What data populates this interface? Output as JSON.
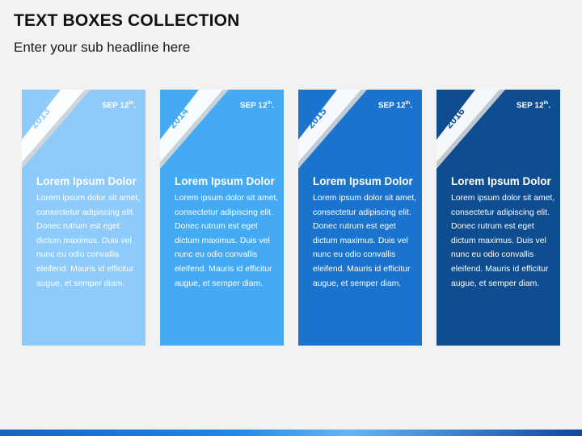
{
  "slide": {
    "title": "TEXT BOXES COLLECTION",
    "subtitle": "Enter your sub headline here"
  },
  "cards": [
    {
      "year": "2013",
      "date_main": "SEP 12",
      "date_suffix": "th",
      "date_tail": ".",
      "heading": "Lorem Ipsum Dolor",
      "body": "Lorem ipsum dolor sit amet, consectetur adipiscing elit. Donec rutrum est eget dictum maximus. Duis vel nunc eu odio convallis eleifend. Mauris id efficitur augue, et semper diam.",
      "color": "#8ecbfa"
    },
    {
      "year": "2014",
      "date_main": "SEP 12",
      "date_suffix": "th",
      "date_tail": ".",
      "heading": "Lorem Ipsum Dolor",
      "body": "Lorem ipsum dolor sit amet, consectetur adipiscing elit. Donec rutrum est eget dictum maximus. Duis vel nunc eu odio convallis eleifend. Mauris id efficitur augue, et semper diam.",
      "color": "#43aaf3"
    },
    {
      "year": "2015",
      "date_main": "SEP 12",
      "date_suffix": "th",
      "date_tail": ".",
      "heading": "Lorem Ipsum Dolor",
      "body": "Lorem ipsum dolor sit amet, consectetur adipiscing elit. Donec rutrum est eget dictum maximus. Duis vel nunc eu odio convallis eleifend. Mauris id efficitur augue, et semper diam.",
      "color": "#1a73cc"
    },
    {
      "year": "2016",
      "date_main": "SEP 12",
      "date_suffix": "th",
      "date_tail": ".",
      "heading": "Lorem Ipsum Dolor",
      "body": "Lorem ipsum dolor sit amet, consectetur adipiscing elit. Donec rutrum est eget dictum maximus. Duis vel nunc eu odio convallis eleifend. Mauris id efficitur augue, et semper diam.",
      "color": "#0e4d8f"
    }
  ],
  "theme": {
    "background": "#f2f2f2",
    "ribbon_color": "#ffffff",
    "accent_bar": "#1565c0"
  }
}
